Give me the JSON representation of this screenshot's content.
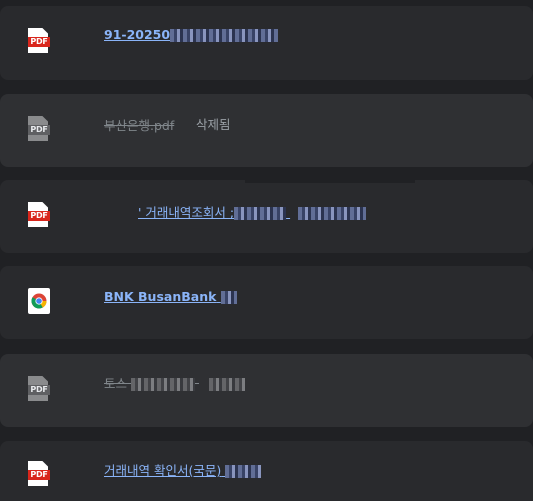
{
  "colors": {
    "background": "#202124",
    "card": "#292a2d",
    "card_deleted": "#2f3033",
    "link": "#8ab4f8",
    "muted": "#80868b",
    "pdf_red": "#d9261c"
  },
  "downloads": [
    {
      "icon": "pdf-icon",
      "title": "91-20250",
      "deleted": false
    },
    {
      "icon": "pdf-icon",
      "title": "부산은행.pdf",
      "status": "삭제됨",
      "deleted": true
    },
    {
      "icon": "pdf-icon",
      "title": "' 거래내역조회서 ;",
      "deleted": false
    },
    {
      "icon": "chrome-icon",
      "title": "BNK BusanBank",
      "deleted": false
    },
    {
      "icon": "pdf-icon",
      "title": "토스",
      "deleted": true
    },
    {
      "icon": "pdf-icon",
      "title": "거래내역 확인서(국문)",
      "deleted": false
    }
  ],
  "icon_text": {
    "pdf": "PDF"
  }
}
